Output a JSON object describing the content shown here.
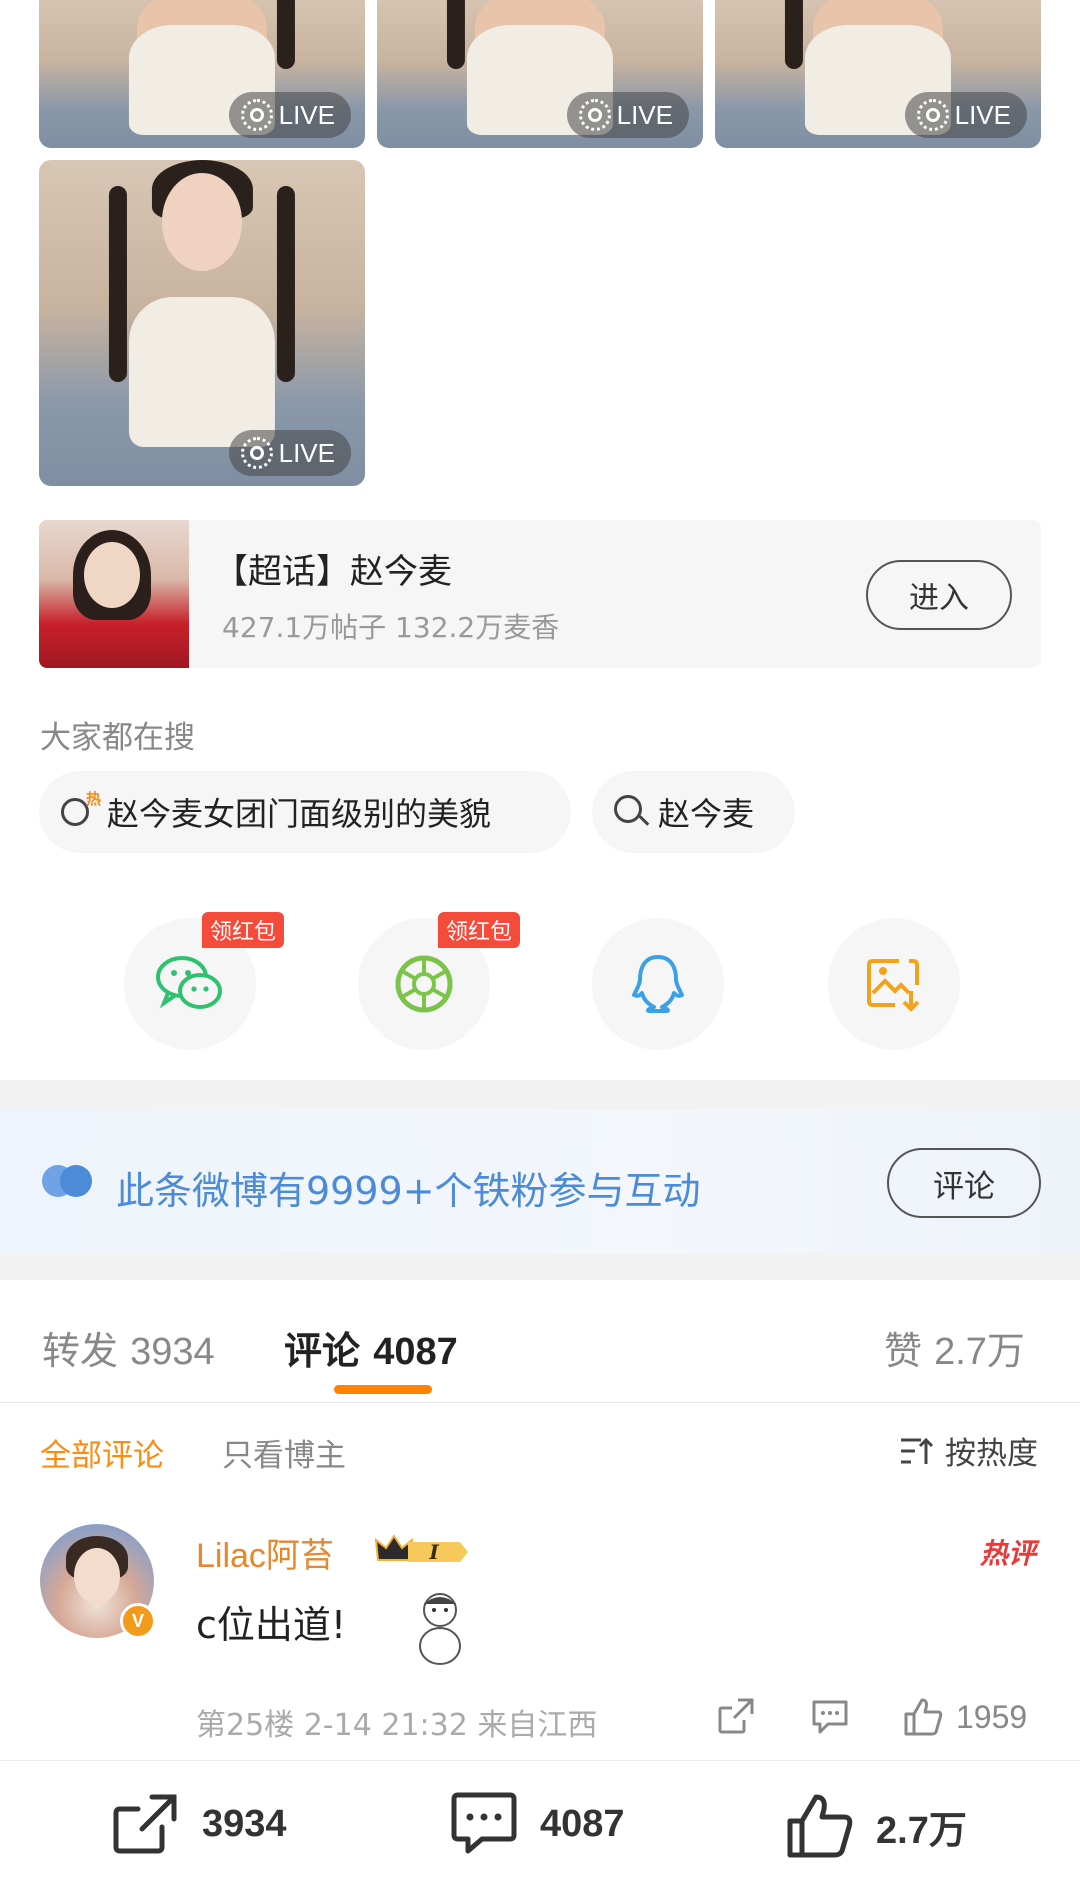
{
  "photos": {
    "live_label": "LIVE"
  },
  "super_topic": {
    "title": "【超话】赵今麦",
    "stats": "427.1万帖子 132.2万麦香",
    "enter_label": "进入"
  },
  "searching": {
    "heading": "大家都在搜",
    "hot_tag": "热",
    "items": [
      {
        "label": "赵今麦女团门面级别的美貌",
        "icon": "hot-search-icon"
      },
      {
        "label": "赵今麦",
        "icon": "search-icon"
      }
    ]
  },
  "share": {
    "items": [
      {
        "name": "wechat",
        "icon": "wechat-icon",
        "tag": "领红包"
      },
      {
        "name": "moments",
        "icon": "moments-icon",
        "tag": "领红包"
      },
      {
        "name": "qq",
        "icon": "qq-icon",
        "tag": ""
      },
      {
        "name": "save-image",
        "icon": "save-image-icon",
        "tag": ""
      }
    ]
  },
  "fans_banner": {
    "text": "此条微博有9999+个铁粉参与互动",
    "button_label": "评论"
  },
  "tabs": {
    "repost_label": "转发",
    "repost_count": "3934",
    "comment_label": "评论",
    "comment_count": "4087",
    "like_label": "赞",
    "like_count": "2.7万"
  },
  "filters": {
    "all": "全部评论",
    "author_only": "只看博主",
    "sort": "按热度"
  },
  "comment": {
    "username": "Lilac阿苔",
    "verified_badge": "V",
    "level": "I",
    "hot_label": "热评",
    "text": "c位出道!",
    "meta": "第25楼 2-14 21:32 来自江西",
    "likes": "1959"
  },
  "bottom_bar": {
    "repost_count": "3934",
    "comment_count": "4087",
    "like_count": "2.7万"
  },
  "colors": {
    "accent_orange": "#ff8200",
    "link_blue": "#4b8bd8",
    "wechat_green": "#2ec16f",
    "moments_green": "#7cc34a",
    "qq_blue": "#3aa1e8",
    "save_orange": "#f4a21b",
    "red_tag": "#f44b3a"
  }
}
